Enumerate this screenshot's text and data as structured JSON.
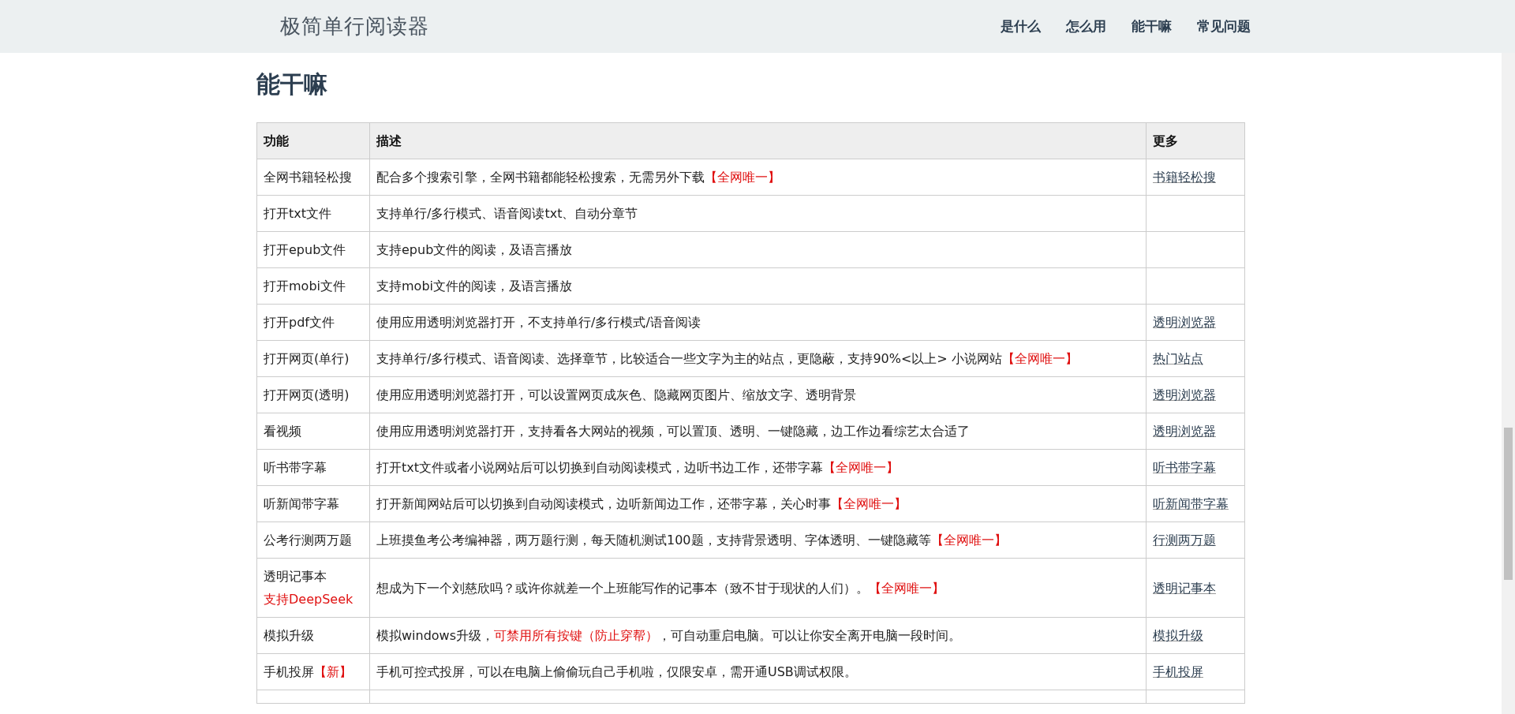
{
  "navbar": {
    "brand": "极简单行阅读器",
    "links": [
      "是什么",
      "怎么用",
      "能干嘛",
      "常见问题"
    ]
  },
  "section_title": "能干嘛",
  "table": {
    "columns": [
      "功能",
      "描述",
      "更多"
    ],
    "rows": [
      {
        "feature": [
          [
            {
              "text": "全网书籍轻松搜",
              "accent": false
            }
          ]
        ],
        "description": [
          {
            "text": "配合多个搜索引擎，全网书籍都能轻松搜索，无需另外下载",
            "accent": false
          },
          {
            "text": "【全网唯一】",
            "accent": true
          }
        ],
        "more": "书籍轻松搜"
      },
      {
        "feature": [
          [
            {
              "text": "打开txt文件",
              "accent": false
            }
          ]
        ],
        "description": [
          {
            "text": "支持单行/多行模式、语音阅读txt、自动分章节",
            "accent": false
          }
        ]
      },
      {
        "feature": [
          [
            {
              "text": "打开epub文件",
              "accent": false
            }
          ]
        ],
        "description": [
          {
            "text": "支持epub文件的阅读，及语言播放",
            "accent": false
          }
        ]
      },
      {
        "feature": [
          [
            {
              "text": "打开mobi文件",
              "accent": false
            }
          ]
        ],
        "description": [
          {
            "text": "支持mobi文件的阅读，及语言播放",
            "accent": false
          }
        ]
      },
      {
        "feature": [
          [
            {
              "text": "打开pdf文件",
              "accent": false
            }
          ]
        ],
        "description": [
          {
            "text": "使用应用透明浏览器打开，不支持单行/多行模式/语音阅读",
            "accent": false
          }
        ],
        "more": "透明浏览器"
      },
      {
        "feature": [
          [
            {
              "text": "打开网页(单行)",
              "accent": false
            }
          ]
        ],
        "description": [
          {
            "text": "支持单行/多行模式、语音阅读、选择章节，比较适合一些文字为主的站点，更隐蔽，支持90%<以上> 小说网站",
            "accent": false
          },
          {
            "text": "【全网唯一】",
            "accent": true
          }
        ],
        "more": "热门站点"
      },
      {
        "feature": [
          [
            {
              "text": "打开网页(透明)",
              "accent": false
            }
          ]
        ],
        "description": [
          {
            "text": "使用应用透明浏览器打开，可以设置网页成灰色、隐藏网页图片、缩放文字、透明背景",
            "accent": false
          }
        ],
        "more": "透明浏览器"
      },
      {
        "feature": [
          [
            {
              "text": "看视频",
              "accent": false
            }
          ]
        ],
        "description": [
          {
            "text": "使用应用透明浏览器打开，支持看各大网站的视频，可以置顶、透明、一键隐藏，边工作边看综艺太合适了",
            "accent": false
          }
        ],
        "more": "透明浏览器"
      },
      {
        "feature": [
          [
            {
              "text": "听书带字幕",
              "accent": false
            }
          ]
        ],
        "description": [
          {
            "text": "打开txt文件或者小说网站后可以切换到自动阅读模式，边听书边工作，还带字幕",
            "accent": false
          },
          {
            "text": "【全网唯一】",
            "accent": true
          }
        ],
        "more": "听书带字幕"
      },
      {
        "feature": [
          [
            {
              "text": "听新闻带字幕",
              "accent": false
            }
          ]
        ],
        "description": [
          {
            "text": "打开新闻网站后可以切换到自动阅读模式，边听新闻边工作，还带字幕，关心时事",
            "accent": false
          },
          {
            "text": "【全网唯一】",
            "accent": true
          }
        ],
        "more": "听新闻带字幕"
      },
      {
        "feature": [
          [
            {
              "text": "公考行测两万题",
              "accent": false
            }
          ]
        ],
        "description": [
          {
            "text": "上班摸鱼考公考编神器，两万题行测，每天随机测试100题，支持背景透明、字体透明、一键隐藏等",
            "accent": false
          },
          {
            "text": "【全网唯一】",
            "accent": true
          }
        ],
        "more": "行测两万题"
      },
      {
        "feature": [
          [
            {
              "text": "透明记事本",
              "accent": false
            }
          ],
          [
            {
              "text": "支持DeepSeek",
              "accent": true
            }
          ]
        ],
        "description": [
          {
            "text": "想成为下一个刘慈欣吗？或许你就差一个上班能写作的记事本（致不甘于现状的人们）。",
            "accent": false
          },
          {
            "text": "【全网唯一】",
            "accent": true
          }
        ],
        "more": "透明记事本"
      },
      {
        "feature": [
          [
            {
              "text": "模拟升级",
              "accent": false
            }
          ]
        ],
        "description": [
          {
            "text": "模拟windows升级，",
            "accent": false
          },
          {
            "text": "可禁用所有按键（防止穿帮）",
            "accent": true
          },
          {
            "text": "，可自动重启电脑。可以让你安全离开电脑一段时间。",
            "accent": false
          }
        ],
        "more": "模拟升级"
      },
      {
        "feature": [
          [
            {
              "text": "手机投屏",
              "accent": false
            },
            {
              "text": "【新】",
              "accent": true
            }
          ]
        ],
        "description": [
          {
            "text": "手机可控式投屏，可以在电脑上偷偷玩自己手机啦，仅限安卓，需开通USB调试权限。",
            "accent": false
          }
        ],
        "more": "手机投屏"
      }
    ]
  }
}
